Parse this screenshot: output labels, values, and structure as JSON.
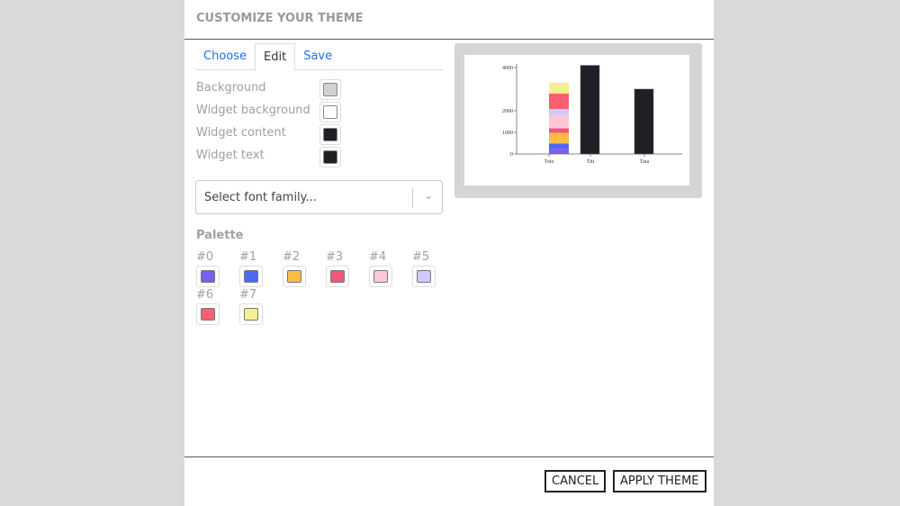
{
  "title": "CUSTOMIZE YOUR THEME",
  "tabs": [
    "Choose",
    "Edit",
    "Save"
  ],
  "fields": [
    {
      "label": "Background",
      "color": "#d0d0d0"
    },
    {
      "label": "Widget background",
      "color": "#ffffff"
    },
    {
      "label": "Widget content",
      "color": "#1e2026"
    },
    {
      "label": "Widget text",
      "color": "#1e2026"
    }
  ],
  "font_placeholder": "Select font family...",
  "palette_label": "Palette",
  "palette": [
    {
      "name": "#0",
      "color": "#7b5cf5"
    },
    {
      "name": "#1",
      "color": "#5067f5"
    },
    {
      "name": "#2",
      "color": "#fbbd44"
    },
    {
      "name": "#3",
      "color": "#f2577a"
    },
    {
      "name": "#4",
      "color": "#fdc8d5"
    },
    {
      "name": "#5",
      "color": "#d0c8fb"
    },
    {
      "name": "#6",
      "color": "#fb5e6e"
    },
    {
      "name": "#7",
      "color": "#f5f08c"
    }
  ],
  "buttons": {
    "cancel": "CANCEL",
    "apply": "APPLY THEME"
  },
  "chart_data": {
    "type": "bar",
    "categories": [
      "Toto",
      "Titi",
      "Tata"
    ],
    "yticks": [
      "0",
      "1000",
      "2000",
      "4000"
    ],
    "ylim": [
      0,
      4000
    ],
    "toto_stack": [
      220,
      260,
      500,
      210,
      600,
      290,
      710,
      500
    ],
    "values": [
      3290,
      4100,
      3000
    ]
  }
}
